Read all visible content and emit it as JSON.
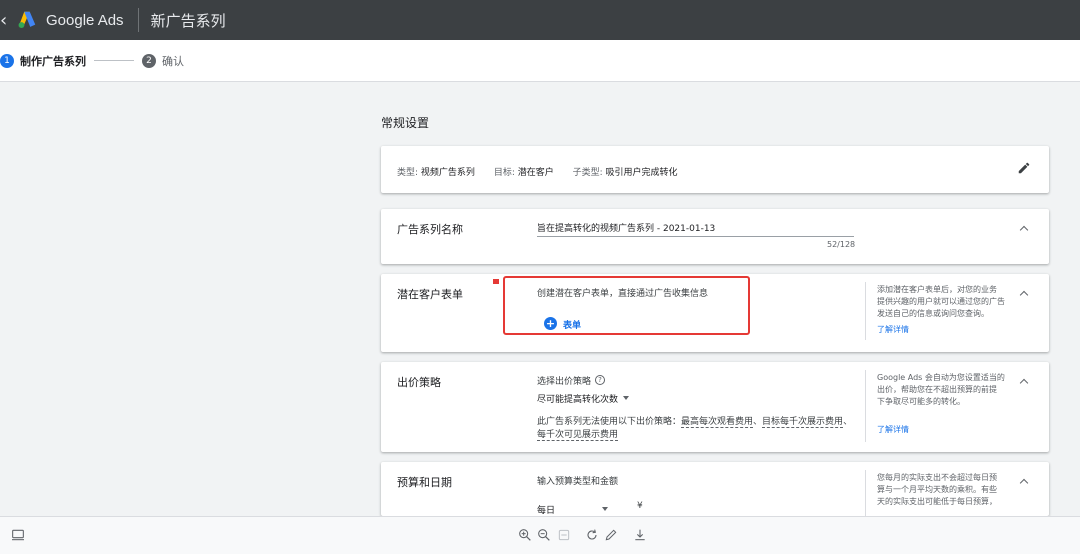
{
  "appbar": {
    "back_icon": "back-arrow-icon",
    "brand": "Google Ads",
    "title": "新广告系列"
  },
  "stepper": {
    "steps": [
      {
        "number": "1",
        "label": "制作广告系列",
        "active": true
      },
      {
        "number": "2",
        "label": "确认",
        "active": false
      }
    ]
  },
  "main": {
    "section_title": "常规设置",
    "summary": {
      "type_label": "类型:",
      "type_value": "视频广告系列",
      "goal_label": "目标:",
      "goal_value": "潜在客户",
      "subtype_label": "子类型:",
      "subtype_value": "吸引用户完成转化"
    },
    "campaign_name": {
      "title": "广告系列名称",
      "value": "旨在提高转化的视频广告系列 - 2021-01-13",
      "counter": "52/128"
    },
    "lead_form": {
      "title": "潜在客户表单",
      "description": "创建潜在客户表单，直接通过广告收集信息",
      "add_label": "表单",
      "side_lines": [
        "添加潜在客户表单后，对您的业务",
        "提供兴趣的用户就可以通过您的广告",
        "发送自己的信息或询问您查询。"
      ],
      "learn_more": "了解详情"
    },
    "bidding": {
      "title": "出价策略",
      "prompt": "选择出价策略",
      "selected": "尽可能提高转化次数",
      "note_prefix": "此广告系列无法使用以下出价策略：",
      "note_link1": "最高每次观看费用",
      "note_sep1": "、",
      "note_link2": "目标每千次展示费用",
      "note_sep2": "、",
      "note_link3": "每千次可见展示费用",
      "side_lines": [
        "Google Ads 会自动为您设置适当的",
        "出价，帮助您在不超出预算的前提",
        "下争取尽可能多的转化。"
      ],
      "learn_more": "了解详情"
    },
    "budget": {
      "title": "预算和日期",
      "prompt": "输入预算类型和金额",
      "budget_type": "每日",
      "currency": "¥",
      "side_lines": [
        "您每月的实际支出不会超过每日预",
        "算与一个月平均天数的乘积。有些",
        "天的实际支出可能低于每日预算，"
      ]
    }
  },
  "colors": {
    "appbar": "#3c4043",
    "accent": "#1a73e8",
    "annotation": "#e53935"
  }
}
